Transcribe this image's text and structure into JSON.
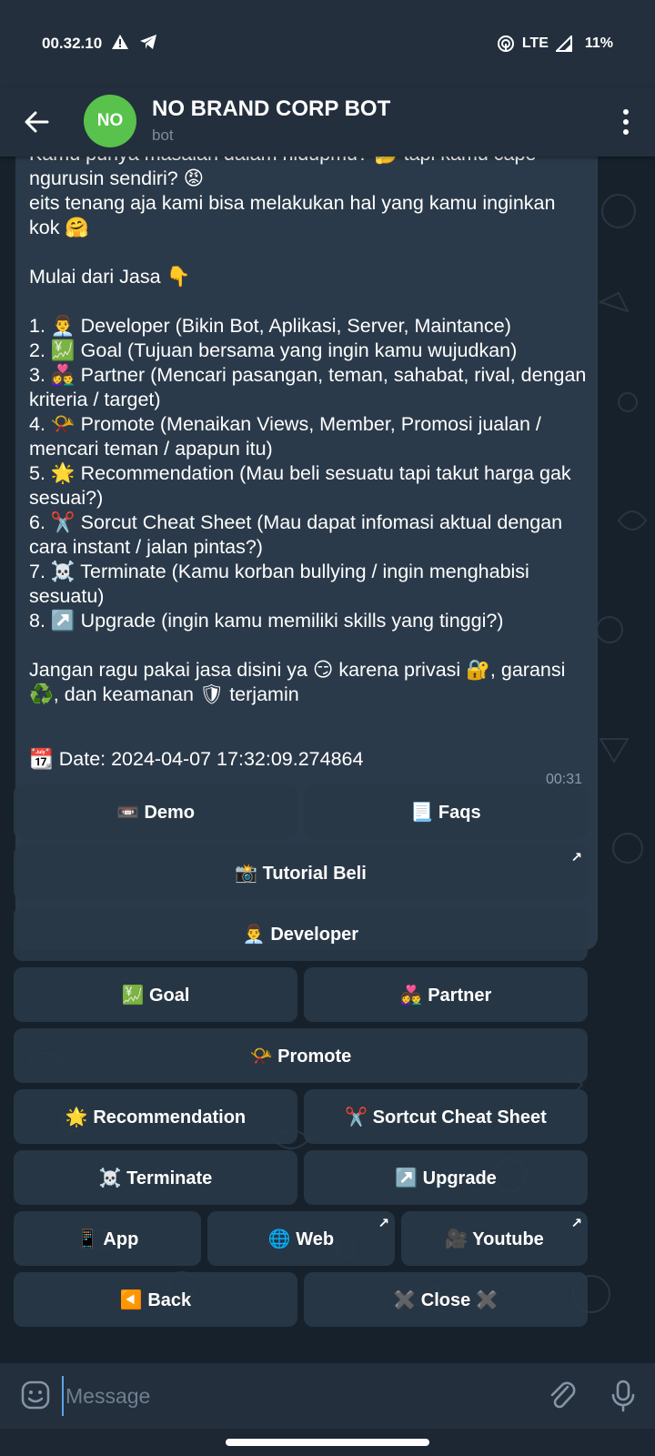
{
  "status": {
    "time": "00.32.10",
    "network": "LTE",
    "battery": "11%"
  },
  "header": {
    "avatar_initials": "NO",
    "title": "NO BRAND CORP BOT",
    "subtitle": "bot"
  },
  "message": {
    "lines": [
      "Kamu punya masalah dalam hidupmu? 🤔 tapi kamu cape ngurusin sendiri? 😡",
      "eits tenang aja kami bisa melakukan hal yang kamu inginkan kok 🤗",
      "",
      "Mulai dari Jasa 👇",
      "",
      "1. 👨‍💼 Developer (Bikin Bot, Aplikasi, Server, Maintance)",
      "2. 💹 Goal (Tujuan bersama yang ingin kamu wujudkan)",
      "3. 👩‍❤️‍👨 Partner (Mencari pasangan, teman, sahabat, rival, dengan kriteria / target)",
      "4. 📯 Promote (Menaikan Views, Member, Promosi jualan / mencari teman / apapun itu)",
      "5. 🌟 Recommendation (Mau beli sesuatu tapi takut harga gak sesuai?)",
      "6. ✂️ Sorcut Cheat Sheet (Mau dapat infomasi aktual dengan cara instant / jalan pintas?)",
      "7. ☠️ Terminate (Kamu korban bullying / ingin menghabisi sesuatu)",
      "8. ↗️ Upgrade (ingin kamu memiliki skills yang tinggi?)",
      "",
      "Jangan ragu pakai jasa disini ya 😏 karena privasi 🔐, garansi ♻️, dan keamanan 🛡 terjamin"
    ],
    "date_line": "📆 Date: 2024-04-07 17:32:09.274864",
    "time": "00:31"
  },
  "keyboard": {
    "demo": "📼 Demo",
    "faqs": "📃 Faqs",
    "tutorial": "📸 Tutorial Beli",
    "developer": "👨‍💼 Developer",
    "goal": "💹 Goal",
    "partner": "👩‍❤️‍👨 Partner",
    "promote": "📯 Promote",
    "recommendation": "🌟 Recommendation",
    "sortcut": "✂️ Sortcut Cheat Sheet",
    "terminate": "☠️ Terminate",
    "upgrade": "↗️ Upgrade",
    "app": "📱 App",
    "web": "🌐 Web",
    "youtube": "🎥 Youtube",
    "back": "◀️ Back",
    "close": "✖️ Close ✖️",
    "external_arrow": "↗"
  },
  "input": {
    "placeholder": "Message"
  },
  "colors": {
    "header_bg": "#232f3d",
    "chat_bg": "#17212c",
    "bubble_bg": "#2b3a4a",
    "button_bg": "#293847",
    "avatar_bg": "#58c24c",
    "accent": "#5ea5e4"
  }
}
